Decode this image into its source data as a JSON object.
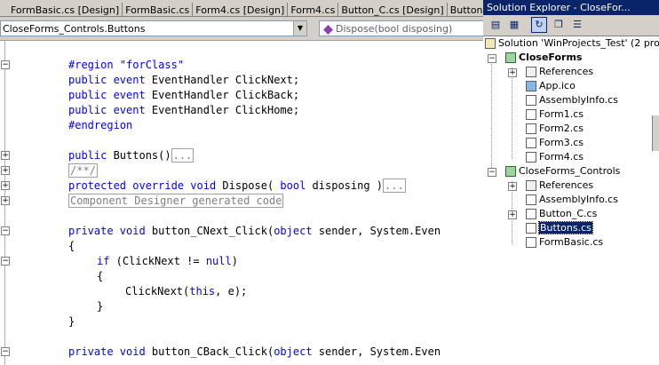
{
  "tabs": [
    "FormBasic.cs [Design]",
    "FormBasic.cs",
    "Form4.cs [Design]",
    "Form4.cs",
    "Button_C.cs [Design]",
    "Buttons.cs [De"
  ],
  "nav": {
    "class_combo": "CloseForms_Controls.Buttons",
    "member_combo": "Dispose(bool disposing)"
  },
  "code": {
    "line1": "#region \"forClass\"",
    "l2_kw": "public event",
    "l2_rest": " EventHandler ClickNext;",
    "l3_kw": "public event",
    "l3_rest": " EventHandler ClickBack;",
    "l4_kw": "public event",
    "l4_rest": " EventHandler ClickHome;",
    "line5": "#endregion",
    "l6_kw": "public",
    "l6_rest": " Buttons()",
    "ellipsis": "...",
    "l7": "/**/",
    "l8_kw1": "protected override void",
    "l8_mid": " Dispose( ",
    "l8_kw2": "bool",
    "l8_rest": " disposing )",
    "l9": "Component Designer generated code",
    "l10_kw": "private void",
    "l10_mid": " button_CNext_Click(",
    "l10_kw2": "object",
    "l10_rest": " sender, System.Even",
    "brace_open": "{",
    "l12_kw": "if",
    "l12_mid": " (ClickNext != ",
    "l12_kw2": "null",
    "l12_rest": ")",
    "l14_a": "ClickNext(",
    "l14_kw": "this",
    "l14_b": ", e);",
    "brace_close": "}",
    "l17_kw": "private void",
    "l17_mid": " button_CBack_Click(",
    "l17_kw2": "object",
    "l17_rest": " sender, System.Even"
  },
  "explorer": {
    "title": "Solution Explorer - CloseFor...",
    "solution": "Solution 'WinProjects_Test' (2 pro",
    "project1": "CloseForms",
    "p1_items": [
      "References",
      "App.ico",
      "AssemblyInfo.cs",
      "Form1.cs",
      "Form2.cs",
      "Form3.cs",
      "Form4.cs"
    ],
    "project2": "CloseForms_Controls",
    "p2_items": [
      "References",
      "AssemblyInfo.cs",
      "Button_C.cs",
      "Buttons.cs",
      "FormBasic.cs"
    ]
  },
  "colors": {
    "keyword": "#0000ff",
    "selection": "#0a246a",
    "collapsed_text": "#808080"
  }
}
